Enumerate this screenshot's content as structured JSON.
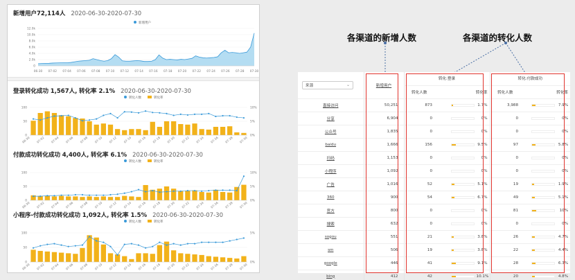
{
  "left": {
    "sections": [
      {
        "title": "新增用户",
        "value": "72,114人",
        "extra": "",
        "range": "2020-06-30-2020-07-30",
        "legend": [
          "新增用户"
        ],
        "y_ticks": [
          "12.0k",
          "10.0k",
          "8.0k",
          "6.0k",
          "4.0k",
          "2.0k",
          "0"
        ],
        "x_ticks": [
          "06-30",
          "07-02",
          "07-04",
          "07-06",
          "07-08",
          "07-10",
          "07-12",
          "07-14",
          "07-16",
          "07-18",
          "07-20",
          "07-22",
          "07-24",
          "07-26",
          "07-28",
          "07-30"
        ]
      },
      {
        "title": "登录转化成功",
        "value": "1,567人,",
        "extra": "转化率 2.1%",
        "range": "2020-06-30-2020-07-30",
        "legend": [
          "转化人数",
          "转化率"
        ],
        "y_left": [
          "100",
          "50",
          "0"
        ],
        "y_right": [
          "10%",
          "5%",
          "0%"
        ],
        "x_ticks": [
          "06-30",
          "07-02",
          "07-04",
          "07-06",
          "07-08",
          "07-10",
          "07-12",
          "07-14",
          "07-16",
          "07-18",
          "07-20",
          "07-22",
          "07-24",
          "07-26",
          "07-28",
          "07-30"
        ]
      },
      {
        "title": "付款成功转化成功",
        "value": "4,400人,",
        "extra": "转化率 6.1%",
        "range": "2020-06-30-2020-07-30",
        "legend": [
          "转化人数",
          "转化率"
        ],
        "y_left": [
          "100",
          "50",
          "0"
        ],
        "y_right": [
          "10%",
          "5%",
          "0%"
        ],
        "x_ticks": [
          "06-30",
          "07-02",
          "07-04",
          "07-06",
          "07-08",
          "07-10",
          "07-12",
          "07-14",
          "07-16",
          "07-18",
          "07-20",
          "07-22",
          "07-24",
          "07-26",
          "07-28",
          "07-30"
        ]
      },
      {
        "title": "小程序-付款成功转化成功",
        "value": "1,092人,",
        "extra": "转化率 1.5%",
        "range": "2020-06-30-2020-07-30",
        "legend": [
          "转化人数",
          "转化率"
        ],
        "y_left": [
          "100",
          "50",
          "0"
        ],
        "y_right": [
          "5%",
          "0%"
        ],
        "x_ticks": [
          "06-30",
          "07-02",
          "07-04",
          "07-06",
          "07-08",
          "07-10",
          "07-12",
          "07-14",
          "07-16",
          "07-18",
          "07-20",
          "07-22",
          "07-24",
          "07-26",
          "07-28",
          "07-30"
        ]
      }
    ]
  },
  "chart_data": [
    {
      "type": "area",
      "title": "新增用户72,114人",
      "series": [
        {
          "name": "新增用户",
          "values": [
            700,
            750,
            800,
            820,
            900,
            950,
            980,
            1000,
            1000,
            1100,
            1300,
            1500,
            1600,
            1700,
            1800,
            2300,
            2000,
            1700,
            1500,
            1700,
            2300,
            3600,
            2800,
            1600,
            1500,
            1500,
            1600,
            1700,
            1600,
            1400,
            1400,
            1500,
            2000,
            3500,
            2500,
            2000,
            2100,
            2000,
            1900,
            2100,
            2000,
            2200,
            2400,
            3200,
            2800,
            2600,
            2500,
            2600,
            2700,
            2900,
            4200,
            5000,
            4200,
            4300,
            4200,
            4000,
            4200,
            4400,
            6000,
            10500
          ]
        }
      ],
      "ylim": [
        0,
        12000
      ],
      "colors": {
        "fill": "#a7d7f0",
        "line": "#3a9ad9"
      }
    },
    {
      "type": "bar",
      "title": "登录转化成功 1,567人, 转化率 2.1%",
      "categories_count": 31,
      "series": [
        {
          "name": "转化人数",
          "values": [
            52,
            80,
            86,
            80,
            72,
            68,
            62,
            60,
            50,
            38,
            42,
            38,
            22,
            18,
            22,
            22,
            18,
            48,
            30,
            50,
            50,
            40,
            38,
            42,
            22,
            20,
            30,
            30,
            32,
            10,
            8
          ]
        },
        {
          "name": "转化率",
          "values": [
            4.5,
            4.2,
            4.8,
            5.3,
            5.4,
            5.5,
            4.8,
            4.0,
            4.2,
            4.5,
            5.5,
            6.0,
            4.8,
            6.5,
            6.4,
            6.2,
            6.7,
            6.3,
            6.2,
            6.0,
            5.5,
            5.8,
            5.6,
            5.8,
            5.8,
            6.0,
            5.2,
            5.4,
            5.4,
            5.0,
            4.8
          ]
        }
      ],
      "ylim": [
        0,
        100
      ]
    },
    {
      "type": "bar",
      "title": "付款成功转化成功 4,400人, 转化率 6.1%",
      "categories_count": 31,
      "series": [
        {
          "name": "转化人数",
          "values": [
            18,
            16,
            16,
            14,
            16,
            14,
            14,
            12,
            14,
            12,
            14,
            12,
            12,
            16,
            14,
            12,
            55,
            38,
            42,
            50,
            42,
            34,
            34,
            36,
            30,
            28,
            38,
            30,
            28,
            48,
            56
          ]
        },
        {
          "name": "转化率",
          "values": [
            1.6,
            1.6,
            1.8,
            1.8,
            2.0,
            2.0,
            2.2,
            2.2,
            2.0,
            2.0,
            2.0,
            2.2,
            2.4,
            2.8,
            3.4,
            4.2,
            3.4,
            3.8,
            3.2,
            3.4,
            3.6,
            3.6,
            3.8,
            3.8,
            3.6,
            3.8,
            4.0,
            4.0,
            4.0,
            3.8,
            9.5
          ]
        }
      ],
      "ylim": [
        0,
        100
      ]
    },
    {
      "type": "bar",
      "title": "小程序-付款成功转化成功 1,092人, 转化率 1.5%",
      "categories_count": 31,
      "series": [
        {
          "name": "转化人数",
          "values": [
            42,
            38,
            36,
            34,
            32,
            30,
            28,
            48,
            92,
            84,
            60,
            30,
            26,
            20,
            10,
            30,
            30,
            28,
            58,
            70,
            40,
            30,
            28,
            26,
            24,
            20,
            18,
            16,
            14,
            12,
            20
          ]
        },
        {
          "name": "转化率",
          "values": [
            2.0,
            2.3,
            2.5,
            2.6,
            2.4,
            2.2,
            2.3,
            2.4,
            3.6,
            3.0,
            2.8,
            2.2,
            1.0,
            2.5,
            2.6,
            2.4,
            2.0,
            2.2,
            2.8,
            2.4,
            2.6,
            2.4,
            2.6,
            2.6,
            2.8,
            2.8,
            2.8,
            2.8,
            3.0,
            3.2,
            3.4
          ]
        }
      ],
      "ylim": [
        0,
        100
      ]
    }
  ],
  "callouts": {
    "new_users": "各渠道的新增人数",
    "conversion": "各渠道的转化人数"
  },
  "table": {
    "select": "来源",
    "headers": {
      "new_users": "新增用户",
      "group1": "转化:登录",
      "group2": "转化:付款成功",
      "count": "转化人数",
      "rate": "转化率"
    },
    "rows": [
      {
        "source": "直接访问",
        "new": "50,251",
        "c1": "873",
        "r1": "1.7%",
        "f1": 0.17,
        "c2": "3,988",
        "r2": "7.9%",
        "f2": 0.79
      },
      {
        "source": "分享",
        "new": "6,904",
        "c1": "0",
        "r1": "0%",
        "f1": 0,
        "c2": "0",
        "r2": "0%",
        "f2": 0
      },
      {
        "source": "公众号",
        "new": "1,835",
        "c1": "0",
        "r1": "0%",
        "f1": 0,
        "c2": "0",
        "r2": "0%",
        "f2": 0
      },
      {
        "source": "baidu",
        "new": "1,666",
        "c1": "156",
        "r1": "9.5%",
        "f1": 0.95,
        "c2": "97",
        "r2": "5.8%",
        "f2": 0.58
      },
      {
        "source": "扫码",
        "new": "1,153",
        "c1": "0",
        "r1": "0%",
        "f1": 0,
        "c2": "0",
        "r2": "0%",
        "f2": 0
      },
      {
        "source": "小程序",
        "new": "1,092",
        "c1": "0",
        "r1": "0%",
        "f1": 0,
        "c2": "0",
        "r2": "0%",
        "f2": 0
      },
      {
        "source": "广告",
        "new": "1,016",
        "c1": "52",
        "r1": "5.1%",
        "f1": 0.51,
        "c2": "19",
        "r2": "1.9%",
        "f2": 0.19
      },
      {
        "source": "360",
        "new": "900",
        "c1": "54",
        "r1": "6.7%",
        "f1": 0.67,
        "c2": "49",
        "r2": "5.1%",
        "f2": 0.51
      },
      {
        "source": "官方",
        "new": "800",
        "c1": "0",
        "r1": "0%",
        "f1": 0,
        "c2": "81",
        "r2": "10%",
        "f2": 1.0
      },
      {
        "source": "搜索",
        "new": "632",
        "c1": "0",
        "r1": "0%",
        "f1": 0,
        "c2": "0",
        "r2": "0%",
        "f2": 0
      },
      {
        "source": "sogou",
        "new": "551",
        "c1": "21",
        "r1": "3.8%",
        "f1": 0.38,
        "c2": "26",
        "r2": "4.7%",
        "f2": 0.47
      },
      {
        "source": "sm",
        "new": "506",
        "c1": "19",
        "r1": "3.8%",
        "f1": 0.38,
        "c2": "22",
        "r2": "4.4%",
        "f2": 0.44
      },
      {
        "source": "google",
        "new": "446",
        "c1": "41",
        "r1": "9.1%",
        "f1": 0.91,
        "c2": "28",
        "r2": "6.3%",
        "f2": 0.63
      },
      {
        "source": "bing",
        "new": "412",
        "c1": "42",
        "r1": "10.1%",
        "f1": 1.0,
        "c2": "20",
        "r2": "4.8%",
        "f2": 0.48
      }
    ]
  },
  "colors": {
    "bar": "#f2b21a",
    "line": "#3a9ad9",
    "area": "#a7d7f0",
    "annotation": "#e0322c"
  }
}
